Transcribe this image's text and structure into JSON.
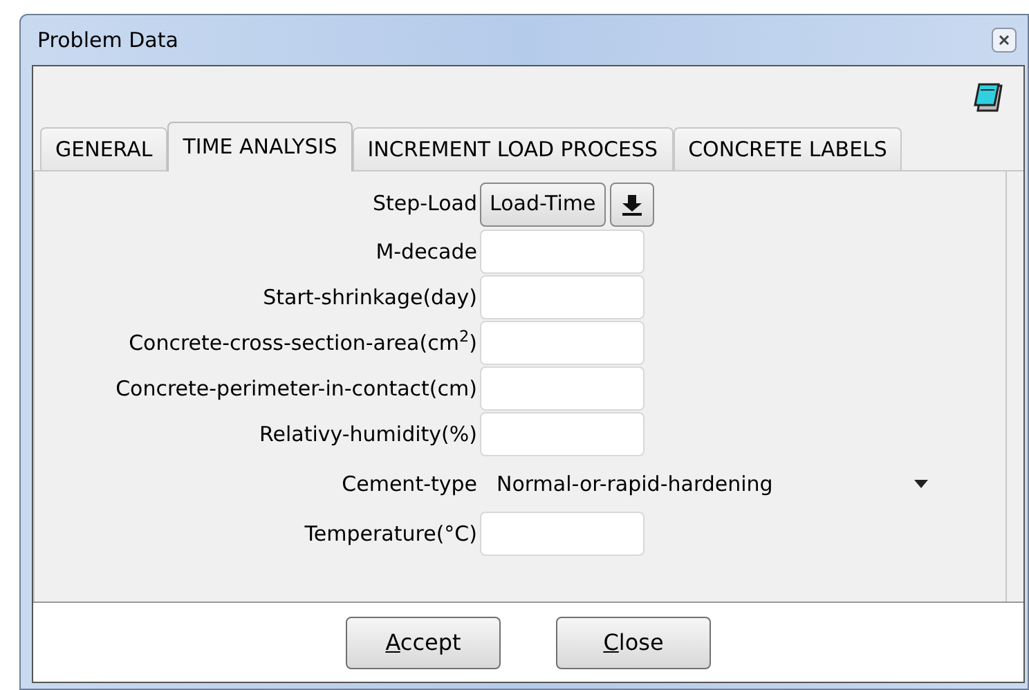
{
  "window": {
    "title": "Problem Data"
  },
  "tabs": [
    {
      "label": "GENERAL",
      "selected": false
    },
    {
      "label": "TIME ANALYSIS",
      "selected": true
    },
    {
      "label": "INCREMENT LOAD PROCESS",
      "selected": false
    },
    {
      "label": "CONCRETE LABELS",
      "selected": false
    }
  ],
  "fields": [
    {
      "kind": "button",
      "label": "Step-Load",
      "button": "Load-Time"
    },
    {
      "kind": "text",
      "label": "M-decade"
    },
    {
      "kind": "text",
      "label": "Start-shrinkage(day)"
    },
    {
      "kind": "text",
      "label": "Concrete-cross-section-area(cm$^{2}$)"
    },
    {
      "kind": "text",
      "label": "Concrete-perimeter-in-contact(cm)"
    },
    {
      "kind": "text",
      "label": "Relativy-humidity(%)"
    },
    {
      "kind": "dropdown",
      "label": "Cement-type",
      "value": "Normal-or-rapid-hardening"
    },
    {
      "kind": "text",
      "label": "Temperature(°C)"
    }
  ],
  "buttons": [
    "Accept",
    "Close"
  ]
}
